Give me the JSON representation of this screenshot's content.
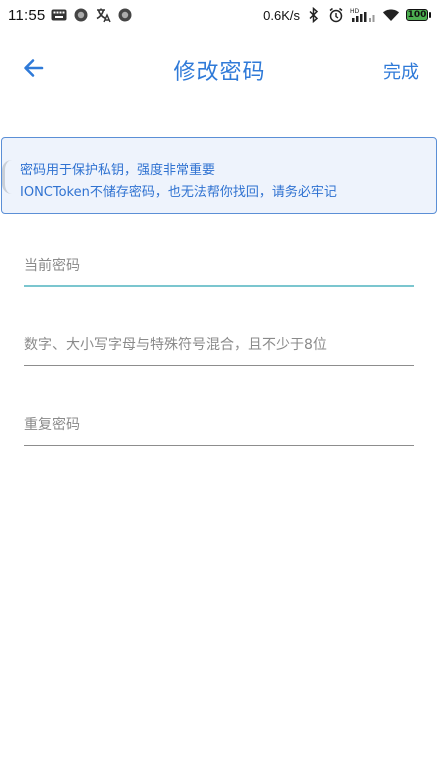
{
  "status_bar": {
    "time": "11:55",
    "network_speed": "0.6K/s",
    "network_type": "HD",
    "battery_level": "100",
    "left_icons": [
      "keyboard-icon",
      "record-icon",
      "translate-icon",
      "record-icon"
    ],
    "right_icons": [
      "bluetooth-icon",
      "alarm-icon",
      "signal-icon",
      "wifi-icon",
      "battery-icon"
    ]
  },
  "header": {
    "title": "修改密码",
    "done_label": "完成",
    "back_icon": "arrow-left-icon"
  },
  "notice": {
    "line1": "密码用于保护私钥，强度非常重要",
    "line2": "IONCToken不储存密码，也无法帮你找回，请务必牢记"
  },
  "form": {
    "current_password": {
      "value": "",
      "placeholder": "当前密码"
    },
    "new_password": {
      "value": "",
      "placeholder": "数字、大小写字母与特殊符号混合，且不少于8位"
    },
    "repeat_password": {
      "value": "",
      "placeholder": "重复密码"
    }
  },
  "colors": {
    "accent": "#2f7ad8",
    "notice_border": "#5b8fd6",
    "notice_bg": "#eef3fc",
    "active_underline": "#7bc6cf",
    "underline": "#8d8d8d",
    "battery": "#4caf50"
  }
}
